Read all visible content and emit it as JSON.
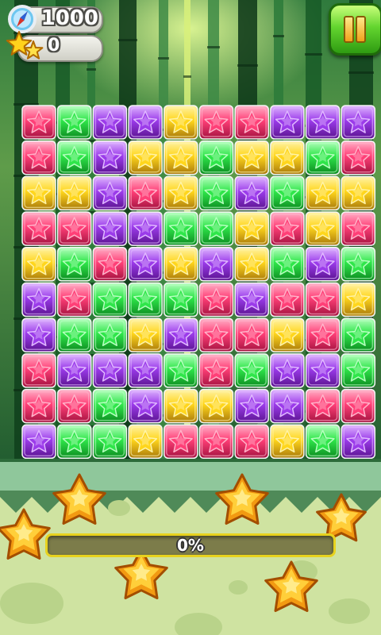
{
  "hud": {
    "score": "1000",
    "stars": "0",
    "score_icon": "compass-icon",
    "stars_icon": "gold-stars-icon",
    "pause_icon": "pause-icon"
  },
  "progress": {
    "label": "0%",
    "fraction": 0
  },
  "colors": {
    "pink": "#ff3f77",
    "green": "#2fe64a",
    "purple": "#9b3bea",
    "yellow": "#ffd61c",
    "pause_green": "#63d52f",
    "progress_border": "#e7d21e"
  },
  "board": {
    "rows": 10,
    "cols": 10,
    "tiles": [
      [
        "pink",
        "green",
        "purple",
        "purple",
        "yellow",
        "pink",
        "pink",
        "purple",
        "purple",
        "purple"
      ],
      [
        "pink",
        "green",
        "purple",
        "yellow",
        "yellow",
        "green",
        "yellow",
        "yellow",
        "green",
        "pink"
      ],
      [
        "yellow",
        "yellow",
        "purple",
        "pink",
        "yellow",
        "green",
        "purple",
        "green",
        "yellow",
        "yellow"
      ],
      [
        "pink",
        "pink",
        "purple",
        "purple",
        "green",
        "green",
        "yellow",
        "pink",
        "yellow",
        "pink"
      ],
      [
        "yellow",
        "green",
        "pink",
        "purple",
        "yellow",
        "purple",
        "yellow",
        "green",
        "purple",
        "green"
      ],
      [
        "purple",
        "pink",
        "green",
        "green",
        "green",
        "pink",
        "purple",
        "pink",
        "pink",
        "yellow"
      ],
      [
        "purple",
        "green",
        "green",
        "yellow",
        "purple",
        "pink",
        "pink",
        "yellow",
        "pink",
        "green"
      ],
      [
        "pink",
        "purple",
        "purple",
        "purple",
        "green",
        "pink",
        "green",
        "purple",
        "purple",
        "green"
      ],
      [
        "pink",
        "pink",
        "green",
        "purple",
        "yellow",
        "yellow",
        "purple",
        "purple",
        "pink",
        "pink"
      ],
      [
        "purple",
        "green",
        "green",
        "yellow",
        "pink",
        "pink",
        "pink",
        "yellow",
        "green",
        "purple"
      ]
    ]
  }
}
